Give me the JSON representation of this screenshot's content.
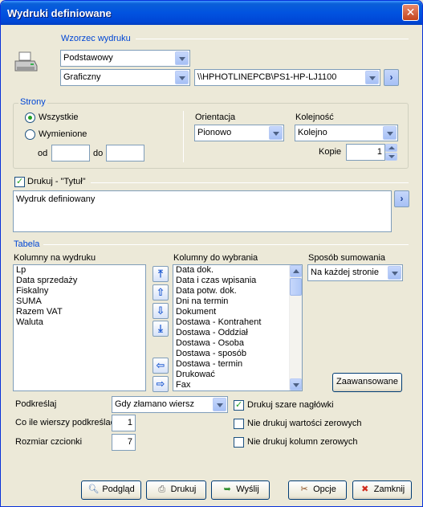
{
  "window": {
    "title": "Wydruki definiowane",
    "close": "✕"
  },
  "wzorzec": {
    "legend": "Wzorzec wydruku",
    "template": "Podstawowy",
    "mode": "Graficzny",
    "printer": "\\\\HPHOTLINEPCB\\PS1-HP-LJ1100"
  },
  "strony": {
    "legend": "Strony",
    "all": "Wszystkie",
    "listed": "Wymienione",
    "from_label": "od",
    "from_value": "",
    "to_label": "do",
    "to_value": ""
  },
  "orientacja": {
    "label": "Orientacja",
    "value": "Pionowo"
  },
  "kolejnosc": {
    "label": "Kolejność",
    "value": "Kolejno"
  },
  "kopie": {
    "label": "Kopie",
    "value": "1"
  },
  "tytul": {
    "label": "Drukuj - \"Tytuł\"",
    "value": "Wydruk definiowany"
  },
  "tabela": {
    "legend": "Tabela",
    "left_header": "Kolumny na wydruku",
    "left_items": [
      "Lp",
      "Data sprzedaży",
      "Fiskalny",
      "SUMA",
      "Razem VAT",
      "Waluta"
    ],
    "right_header": "Kolumny do wybrania",
    "right_items": [
      "Data dok.",
      "Data i czas wpisania",
      "Data potw. dok.",
      "Dni na termin",
      "Dokument",
      "Dostawa - Kontrahent",
      "Dostawa - Oddział",
      "Dostawa - Osoba",
      "Dostawa - sposób",
      "Dostawa - termin",
      "Drukować",
      "Fax"
    ],
    "sum_label": "Sposób sumowania",
    "sum_value": "Na każdej stronie",
    "advanced": "Zaawansowane"
  },
  "opts": {
    "underline_label": "Podkreślaj",
    "underline_value": "Gdy złamano wiersz",
    "every_label": "Co ile wierszy podkreślać",
    "every_value": "1",
    "font_label": "Rozmiar czcionki",
    "font_value": "7",
    "gray_headers": "Drukuj szare nagłówki",
    "no_zero_values": "Nie drukuj wartości zerowych",
    "no_zero_columns": "Nie drukuj kolumn zerowych"
  },
  "buttons": {
    "preview": "Podgląd",
    "print": "Drukuj",
    "send": "Wyślij",
    "options": "Opcje",
    "close": "Zamknij"
  }
}
